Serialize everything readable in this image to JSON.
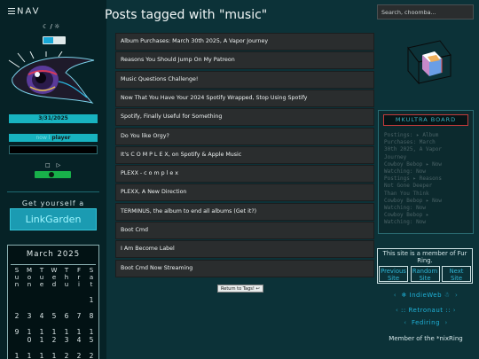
{
  "nav": {
    "menu_label": "NAV"
  },
  "theme": {
    "moon_icon": "☾",
    "divider": "/",
    "sun_icon": "☼"
  },
  "sidebar": {
    "date": "3/31/2025",
    "player": {
      "label_prefix": "now l",
      "label_suffix": "player",
      "controls": [
        "□",
        "▷"
      ],
      "progress": 0.45
    },
    "linkgarden": {
      "title": "Get yourself a",
      "button": "LinkGarden"
    },
    "calendar": {
      "title": "March 2025",
      "weekday_rows": [
        [
          "S",
          "M",
          "T",
          "W",
          "T",
          "F",
          "S"
        ],
        [
          "u",
          "o",
          "u",
          "e",
          "h",
          "r",
          "a"
        ],
        [
          "n",
          "n",
          "e",
          "d",
          "u",
          "i",
          "t"
        ]
      ],
      "date_rows": [
        [
          "",
          "",
          "",
          "",
          "",
          "",
          "1"
        ],
        [
          "2",
          "3",
          "4",
          "5",
          "6",
          "7",
          "8"
        ],
        [
          "9",
          "1",
          "1",
          "1",
          "1",
          "1",
          "1"
        ],
        [
          "",
          "0",
          "1",
          "2",
          "3",
          "4",
          "5"
        ],
        [
          "1",
          "1",
          "1",
          "1",
          "2",
          "2",
          "2"
        ]
      ]
    }
  },
  "main": {
    "title": "Posts tagged with \"music\"",
    "posts": [
      "Album Purchases: March 30th 2025, A Vapor Journey",
      "Reasons You Should Jump On My Patreon",
      "Music Questions Challenge!",
      "Now That You Have Your 2024 Spotify Wrapped, Stop Using Spotify",
      "Spotify, Finally Useful for Something",
      "Do You like Orgy?",
      "It's C O M P L E X, on Spotify & Apple Music",
      "PLEXX - c o m p l e x",
      "PLEXX, A New Direction",
      "TERMINUS, the album to end all albums (Get it?)",
      "Boot Cmd",
      "I Am Become Label",
      "Boot Cmd Now Streaming"
    ],
    "back_button": "Return to Tags! ↩"
  },
  "right": {
    "search_placeholder": "Search, choomba...",
    "board": {
      "title": "MKULTRA BOARD",
      "log": [
        "Postings: ▸ Album",
        "Purchases: March",
        "30th 2025, A Vapor",
        "Journey",
        "Cowboy Bebop ▸ Now",
        "Watching: Now",
        "Postings ▸ Reasons",
        "Not Gone Deeper",
        "Than You Think",
        "Cowboy Bebop ▸ Now",
        "Watching: Now",
        "Cowboy Bebop ▸",
        "Watching: Now"
      ]
    },
    "furring": {
      "caption": "This site is a member of Fur Ring.",
      "links": [
        "Previous Site",
        "Random Site",
        "Next Site"
      ]
    },
    "webrings": [
      "❄ IndieWeb ☃",
      ":: Retronaut ::",
      "Fediring"
    ],
    "nixring": "Member of the *nixRing",
    "colors": {
      "accent": "#18b3c0",
      "background": "#0c3238",
      "post_bg": "#2a2d2e"
    }
  }
}
